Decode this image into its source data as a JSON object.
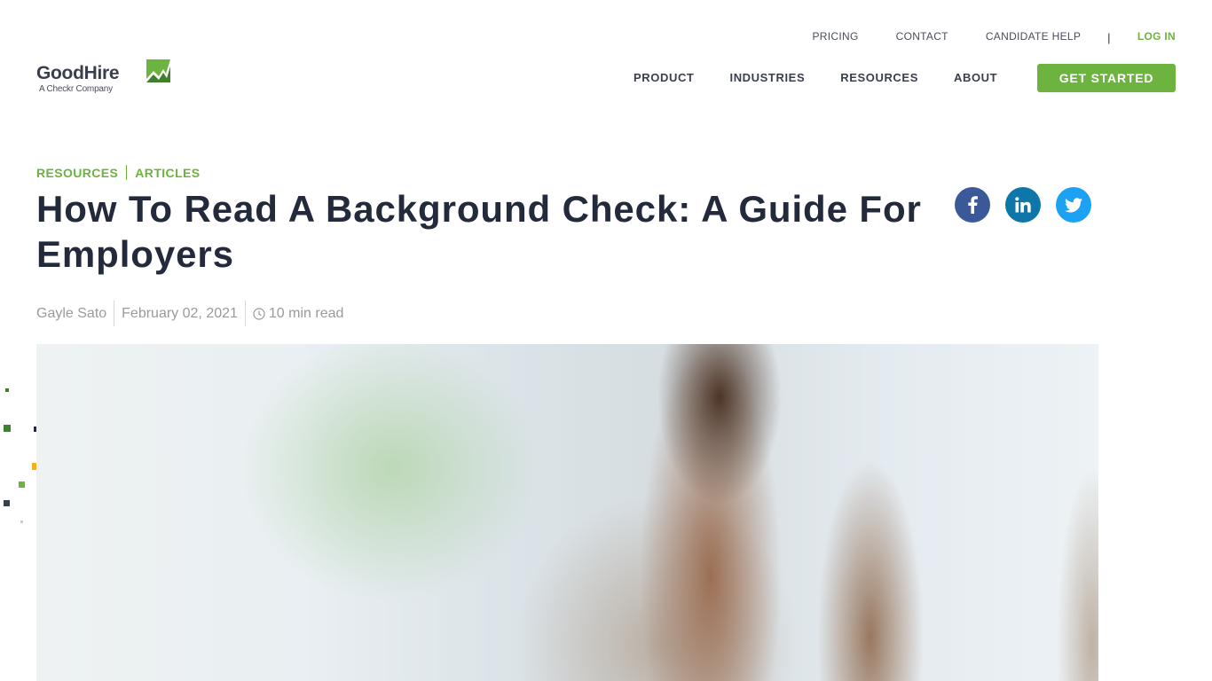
{
  "brand": {
    "name": "GoodHire",
    "tagline": "A Checkr Company",
    "accent_color": "#6cb33f",
    "text_color": "#232a3b"
  },
  "utility_nav": {
    "items": [
      {
        "label": "PRICING"
      },
      {
        "label": "CONTACT"
      },
      {
        "label": "CANDIDATE HELP"
      }
    ],
    "separator": "|",
    "login_label": "LOG IN"
  },
  "main_nav": {
    "items": [
      {
        "label": "PRODUCT"
      },
      {
        "label": "INDUSTRIES"
      },
      {
        "label": "RESOURCES"
      },
      {
        "label": "ABOUT"
      }
    ],
    "cta_label": "GET STARTED"
  },
  "breadcrumb": {
    "items": [
      {
        "label": "RESOURCES"
      },
      {
        "label": "ARTICLES"
      }
    ]
  },
  "article": {
    "title": "How To Read A Background Check: A Guide For Employers",
    "author": "Gayle Sato",
    "date": "February 02, 2021",
    "read_time": "10 min read"
  },
  "social": {
    "facebook": {
      "icon": "facebook-icon",
      "color": "#3b5998"
    },
    "linkedin": {
      "icon": "linkedin-icon",
      "color": "#0e76a8"
    },
    "twitter": {
      "icon": "twitter-icon",
      "color": "#1da1f2"
    }
  },
  "hero_image": {
    "description": "Blurred photo of a person in a bright office"
  }
}
